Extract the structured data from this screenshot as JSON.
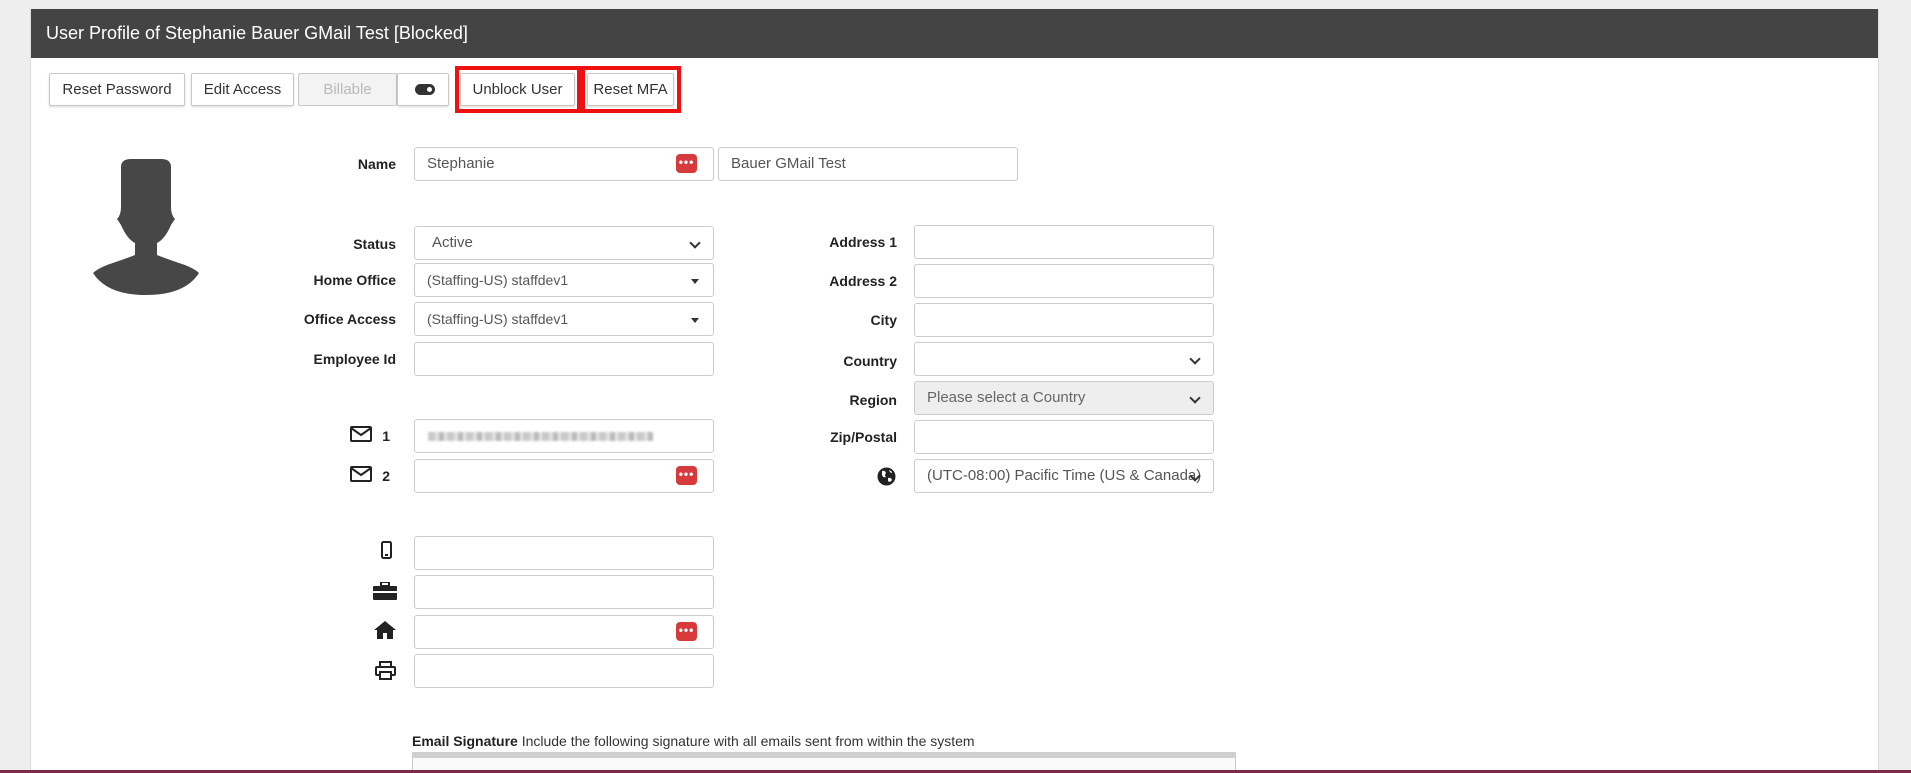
{
  "header": {
    "title": "User Profile of Stephanie Bauer GMail Test [Blocked]"
  },
  "toolbar": {
    "reset_password": "Reset Password",
    "edit_access": "Edit Access",
    "billable": "Billable",
    "unblock_user": "Unblock User",
    "reset_mfa": "Reset MFA"
  },
  "form": {
    "name_label": "Name",
    "first_name": "Stephanie",
    "last_name": "Bauer GMail Test",
    "status_label": "Status",
    "status_value": "Active",
    "home_office_label": "Home Office",
    "home_office_value": "(Staffing-US) staffdev1",
    "office_access_label": "Office Access",
    "office_access_value": "(Staffing-US) staffdev1",
    "employee_id_label": "Employee Id",
    "employee_id_value": "",
    "email1_num": "1",
    "email2_num": "2",
    "email2_value": "",
    "mobile_value": "",
    "work_phone_value": "",
    "home_phone_value": "",
    "fax_value": ""
  },
  "address": {
    "address1_label": "Address 1",
    "address2_label": "Address 2",
    "city_label": "City",
    "country_label": "Country",
    "region_label": "Region",
    "region_value": "Please select a Country",
    "zip_label": "Zip/Postal",
    "timezone_value": "(UTC-08:00) Pacific Time (US & Canada)"
  },
  "signature": {
    "label": "Email Signature",
    "help": " Include the following signature with all emails sent from within the system"
  },
  "colors": {
    "header_bg": "#444444",
    "highlight": "#ee1111",
    "password_badge": "#d63a3a"
  },
  "icons": [
    "user-avatar-icon",
    "mail-icon",
    "mobile-phone-icon",
    "briefcase-icon",
    "home-icon",
    "printer-icon",
    "globe-icon",
    "password-manager-icon",
    "toggle-icon"
  ]
}
